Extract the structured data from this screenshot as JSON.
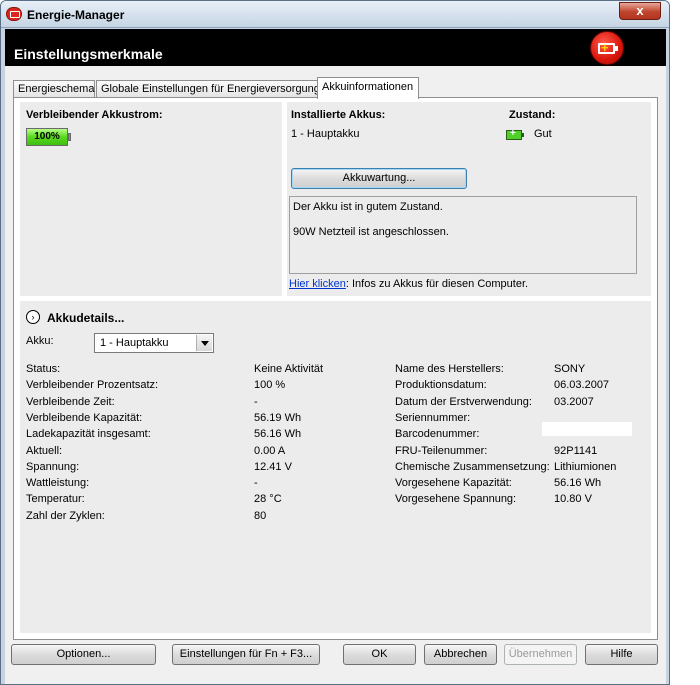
{
  "window": {
    "title": "Energie-Manager",
    "close": "x"
  },
  "header": {
    "title": "Einstellungsmerkmale"
  },
  "tabs": [
    {
      "label": "Energieschema"
    },
    {
      "label": "Globale Einstellungen für Energieversorgung"
    },
    {
      "label": "Akkuinformationen"
    }
  ],
  "remaining": {
    "label": "Verbleibender Akkustrom:",
    "percent_text": "100%",
    "level": 1.0
  },
  "installed": {
    "label": "Installierte Akkus:",
    "item": "1 - Hauptakku"
  },
  "state": {
    "label": "Zustand:",
    "value": "Gut"
  },
  "maintenance_button": "Akkuwartung...",
  "messages": [
    "Der Akku ist in gutem Zustand.",
    "90W Netzteil ist angeschlossen."
  ],
  "info_link": {
    "link": "Hier klicken",
    "text": ": Infos zu Akkus für diesen Computer."
  },
  "details": {
    "title": "Akkudetails...",
    "akku_label": "Akku:",
    "akku_selected": "1 - Hauptakku",
    "left": [
      {
        "key": "Status:",
        "value": "Keine Aktivität"
      },
      {
        "key": "Verbleibender Prozentsatz:",
        "value": "100 %"
      },
      {
        "key": "Verbleibende Zeit:",
        "value": "-"
      },
      {
        "key": "Verbleibende Kapazität:",
        "value": "56.19 Wh"
      },
      {
        "key": "Ladekapazität insgesamt:",
        "value": "56.16 Wh"
      },
      {
        "key": "Aktuell:",
        "value": "0.00 A"
      },
      {
        "key": "Spannung:",
        "value": "12.41 V"
      },
      {
        "key": "Wattleistung:",
        "value": "-"
      },
      {
        "key": "Temperatur:",
        "value": "28 °C"
      },
      {
        "key": "Zahl der Zyklen:",
        "value": "80"
      }
    ],
    "right": [
      {
        "key": "Name des Herstellers:",
        "value": "SONY"
      },
      {
        "key": "Produktionsdatum:",
        "value": "06.03.2007"
      },
      {
        "key": "Datum der Erstverwendung:",
        "value": "03.2007"
      },
      {
        "key": "Seriennummer:",
        "value": ""
      },
      {
        "key": "Barcodenummer:",
        "value": ""
      },
      {
        "key": "FRU-Teilenummer:",
        "value": "92P1141"
      },
      {
        "key": "Chemische Zusammensetzung:",
        "value": "Lithiumionen"
      },
      {
        "key": "Vorgesehene Kapazität:",
        "value": "56.16 Wh"
      },
      {
        "key": "Vorgesehene Spannung:",
        "value": "10.80 V"
      }
    ]
  },
  "buttons": {
    "options": "Optionen...",
    "fn_f3": "Einstellungen für Fn + F3...",
    "ok": "OK",
    "cancel": "Abbrechen",
    "apply": "Übernehmen",
    "help": "Hilfe"
  }
}
